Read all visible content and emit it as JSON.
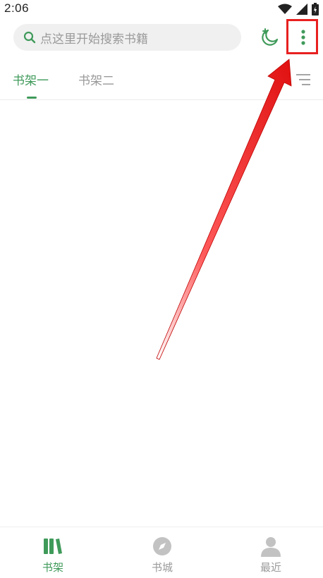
{
  "status_bar": {
    "time": "2:06",
    "icons": [
      "wifi-icon",
      "signal-icon",
      "battery-icon"
    ]
  },
  "header": {
    "search_placeholder": "点这里开始搜索书籍",
    "icons": [
      "search-icon",
      "night-mode-icon",
      "more-vert-icon"
    ]
  },
  "tabs": {
    "items": [
      {
        "label": "书架一",
        "active": true
      },
      {
        "label": "书架二",
        "active": false
      }
    ],
    "filter_icon": "filter-list-icon"
  },
  "bottom_nav": {
    "items": [
      {
        "label": "书架",
        "icon": "bookshelf-icon",
        "active": true
      },
      {
        "label": "书城",
        "icon": "compass-icon",
        "active": false
      },
      {
        "label": "最近",
        "icon": "person-icon",
        "active": false
      }
    ]
  },
  "colors": {
    "accent": "#3f9a5a",
    "annotation": "#e82020",
    "inactive": "#9a9a9a"
  },
  "annotation": {
    "type": "arrow-pointing-to-more-button"
  }
}
